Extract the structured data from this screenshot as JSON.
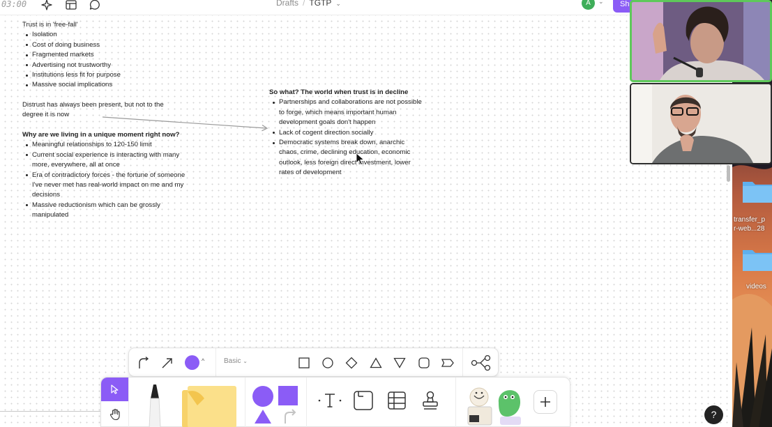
{
  "topbar": {
    "timer": "03:00",
    "breadcrumb_parent": "Drafts",
    "breadcrumb_separator": "/",
    "document_title": "TGTP",
    "avatar_initial": "A",
    "share_label": "Share"
  },
  "canvas_text": {
    "block1": {
      "heading": "Trust is in 'free-fall'",
      "items": [
        "Isolation",
        "Cost of doing business",
        "Fragmented markets",
        "Advertising not trustworthy",
        "Institutions less fit for purpose",
        "Massive social implications"
      ]
    },
    "block2": {
      "text": "Distrust has always been present, but not to the degree it is now"
    },
    "block3": {
      "heading": "Why are we living in a unique moment right now?",
      "items": [
        "Meaningful relationships to 120-150 limit",
        "Current social experience is interacting with many more, everywhere, all at once",
        "Era of contradictory forces - the fortune of someone I've never met has real-world impact on me and my decisions",
        "Massive reductionism which can be grossly manipulated"
      ]
    },
    "block4": {
      "heading": "So what? The world when trust is in decline",
      "items": [
        "Partnerships and collaborations are not possible to forge, which means important human development goals don't happen",
        "Lack of cogent direction socially",
        "Democratic systems break down, anarchic chaos, crime, declining education, economic outlook, less foreign direct investment, lower rates of development"
      ]
    }
  },
  "desktop": {
    "folder1_label_line1": "transfer_p",
    "folder1_label_line2": "r-web...28",
    "folder2_label": "videos"
  },
  "shape_toolbar": {
    "style_label": "Basic",
    "active_color": "#8b5cf6"
  },
  "main_toolbar": {
    "accent_color": "#8b5cf6"
  },
  "help": {
    "label": "?"
  }
}
